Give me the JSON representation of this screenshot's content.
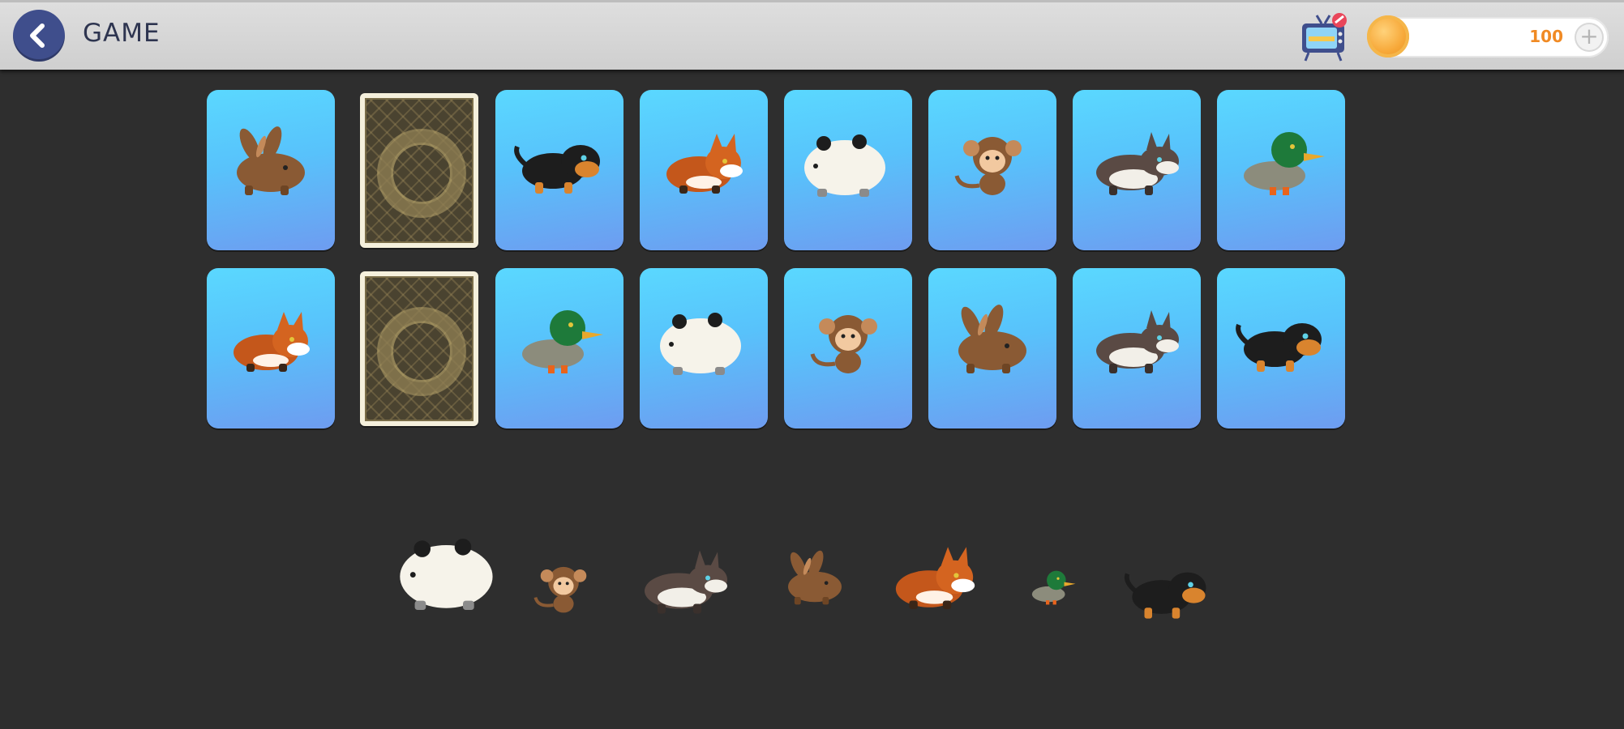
{
  "header": {
    "title": "GAME",
    "coins": "100",
    "plus_label": "+"
  },
  "colors": {
    "accent": "#3f4e8c",
    "card_top": "#5ad8ff",
    "card_bottom": "#6e9cf0",
    "coin": "#f7a93a",
    "background": "#2e2e2e"
  },
  "board": {
    "rows": [
      [
        "rabbit",
        "face-down",
        "dog",
        "fox",
        "panda",
        "monkey",
        "wolf",
        "duck"
      ],
      [
        "fox",
        "face-down",
        "duck",
        "panda",
        "monkey",
        "rabbit",
        "wolf",
        "dog"
      ]
    ]
  },
  "tray": {
    "animals": [
      "panda",
      "monkey",
      "wolf",
      "rabbit",
      "fox",
      "duck",
      "dog"
    ]
  }
}
